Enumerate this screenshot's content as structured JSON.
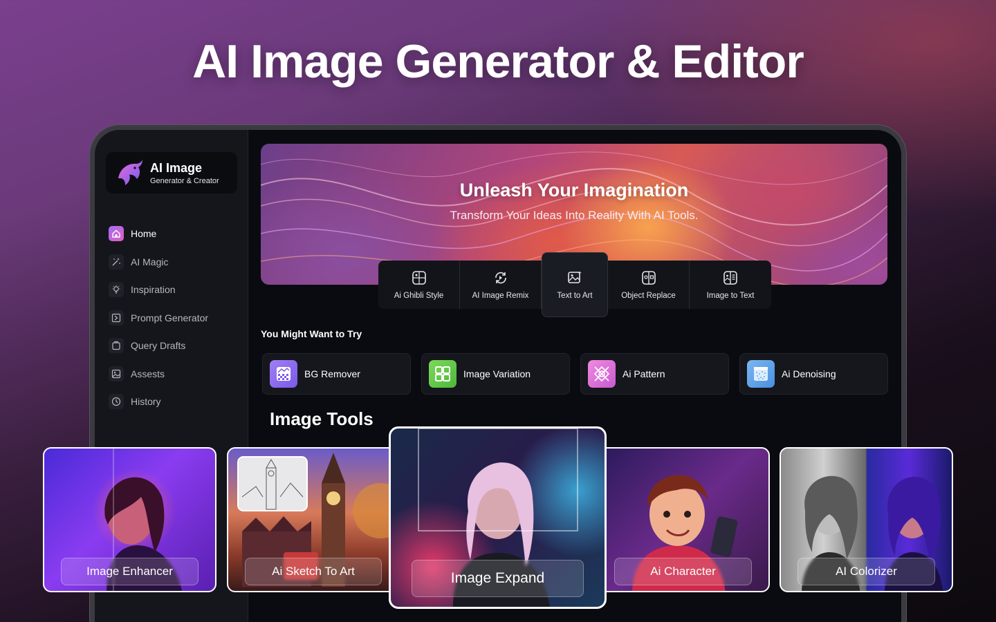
{
  "headline": "AI Image Generator & Editor",
  "brand": {
    "title": "AI Image",
    "subtitle": "Generator & Creator"
  },
  "sidebar": {
    "items": [
      {
        "label": "Home",
        "icon": "home-icon",
        "active": true
      },
      {
        "label": "AI Magic",
        "icon": "magic-wand-icon"
      },
      {
        "label": "Inspiration",
        "icon": "lightbulb-icon"
      },
      {
        "label": "Prompt Generator",
        "icon": "prompt-icon"
      },
      {
        "label": "Query Drafts",
        "icon": "drafts-icon"
      },
      {
        "label": "Assests",
        "icon": "assets-icon"
      },
      {
        "label": "History",
        "icon": "clock-icon"
      }
    ]
  },
  "banner": {
    "title": "Unleash Your Imagination",
    "subtitle": "Transform Your Ideas Into Reality With AI Tools."
  },
  "quick_tools": [
    {
      "label": "Ai Ghibli Style",
      "icon": "ghibli-icon"
    },
    {
      "label": "AI Image Remix",
      "icon": "remix-icon"
    },
    {
      "label": "Text to Art",
      "icon": "text-art-icon",
      "active": true
    },
    {
      "label": "Object Replace",
      "icon": "object-replace-icon"
    },
    {
      "label": "Image to Text",
      "icon": "image-text-icon"
    }
  ],
  "try_section": {
    "title": "You Might Want to Try",
    "items": [
      {
        "label": "BG Remover",
        "icon": "bg-remover-icon",
        "color": "#8b6cf0"
      },
      {
        "label": "Image Variation",
        "icon": "grid-icon",
        "color": "#6cc84a"
      },
      {
        "label": "Ai Pattern",
        "icon": "pattern-icon",
        "color": "#e07ad8"
      },
      {
        "label": "Ai Denoising",
        "icon": "denoise-icon",
        "color": "#5aa0e6"
      }
    ]
  },
  "image_tools": {
    "title": "Image Tools",
    "cards": [
      {
        "label": "Image Enhancer"
      },
      {
        "label": "Ai Sketch To Art"
      },
      {
        "label": "Image Expand"
      },
      {
        "label": "Ai Character"
      },
      {
        "label": "AI Colorizer"
      }
    ]
  }
}
